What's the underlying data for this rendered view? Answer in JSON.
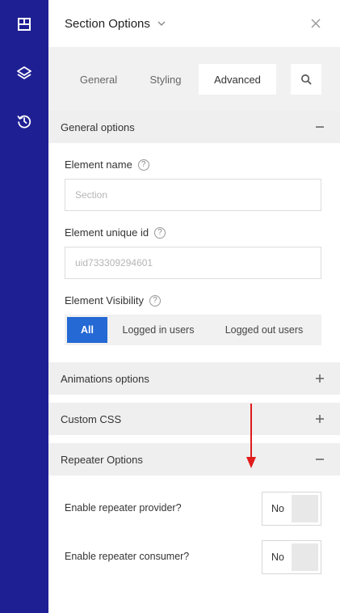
{
  "rail": {
    "items": [
      {
        "icon": "layout-grid-icon"
      },
      {
        "icon": "layers-icon"
      },
      {
        "icon": "history-icon"
      }
    ]
  },
  "header": {
    "title": "Section Options",
    "chevron_icon": "chevron-down-icon",
    "close_icon": "close-icon"
  },
  "tabs": {
    "items": [
      {
        "label": "General"
      },
      {
        "label": "Styling"
      },
      {
        "label": "Advanced",
        "active": true
      }
    ],
    "search_icon": "search-icon"
  },
  "general_options": {
    "title": "General options",
    "state": "expanded",
    "element_name": {
      "label": "Element name",
      "help": "?",
      "placeholder": "Section",
      "value": ""
    },
    "element_unique_id": {
      "label": "Element unique id",
      "help": "?",
      "placeholder": "uid733309294601",
      "value": ""
    },
    "element_visibility": {
      "label": "Element Visibility",
      "help": "?",
      "options": [
        "All",
        "Logged in users",
        "Logged out users"
      ],
      "selected": "All"
    }
  },
  "animations_options": {
    "title": "Animations options",
    "state": "collapsed"
  },
  "custom_css": {
    "title": "Custom CSS",
    "state": "collapsed"
  },
  "repeater_options": {
    "title": "Repeater Options",
    "state": "expanded",
    "provider": {
      "label": "Enable repeater provider?",
      "value": "No"
    },
    "consumer": {
      "label": "Enable repeater consumer?",
      "value": "No"
    }
  },
  "colors": {
    "rail_bg": "#1f1f94",
    "accent": "#2469d4",
    "annotation_arrow": "#e01b1b"
  }
}
